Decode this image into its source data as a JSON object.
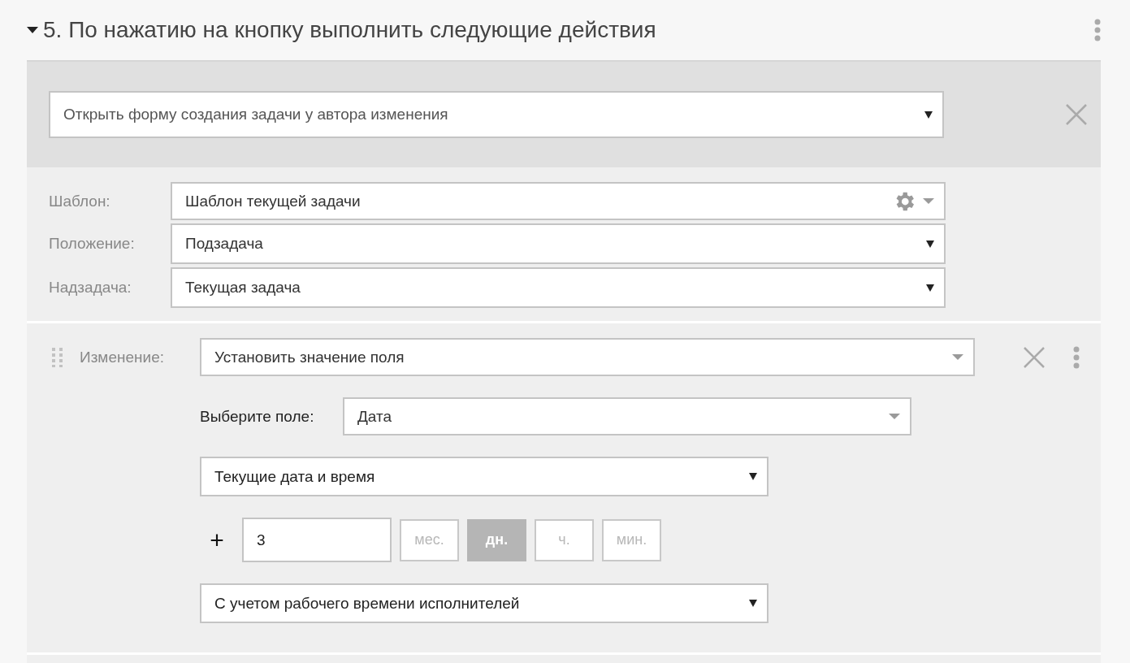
{
  "section": {
    "title": "5. По нажатию на кнопку выполнить следующие действия",
    "expanded": true
  },
  "action": {
    "value": "Открыть форму создания задачи у автора изменения",
    "solid_arrow": true
  },
  "settings": [
    {
      "label": "Шаблон:",
      "value": "Шаблон текущей задачи",
      "solid_arrow": false,
      "gear": true
    },
    {
      "label": "Положение:",
      "value": "Подзадача",
      "solid_arrow": true,
      "gear": false
    },
    {
      "label": "Надзадача:",
      "value": "Текущая задача",
      "solid_arrow": true,
      "gear": false
    }
  ],
  "change": {
    "label": "Изменение:",
    "value": "Установить значение поля",
    "solid_arrow": false,
    "field_label": "Выберите поле:",
    "field_value": "Дата",
    "field_solid_arrow": false,
    "date_base": "Текущие дата и время",
    "date_solid_arrow": true,
    "plus": "+",
    "amount": "3",
    "units": [
      {
        "label": "мес.",
        "selected": false
      },
      {
        "label": "дн.",
        "selected": true
      },
      {
        "label": "ч.",
        "selected": false
      },
      {
        "label": "мин.",
        "selected": false
      }
    ],
    "calendar": "С учетом рабочего времени исполнителей",
    "calendar_solid_arrow": true
  }
}
